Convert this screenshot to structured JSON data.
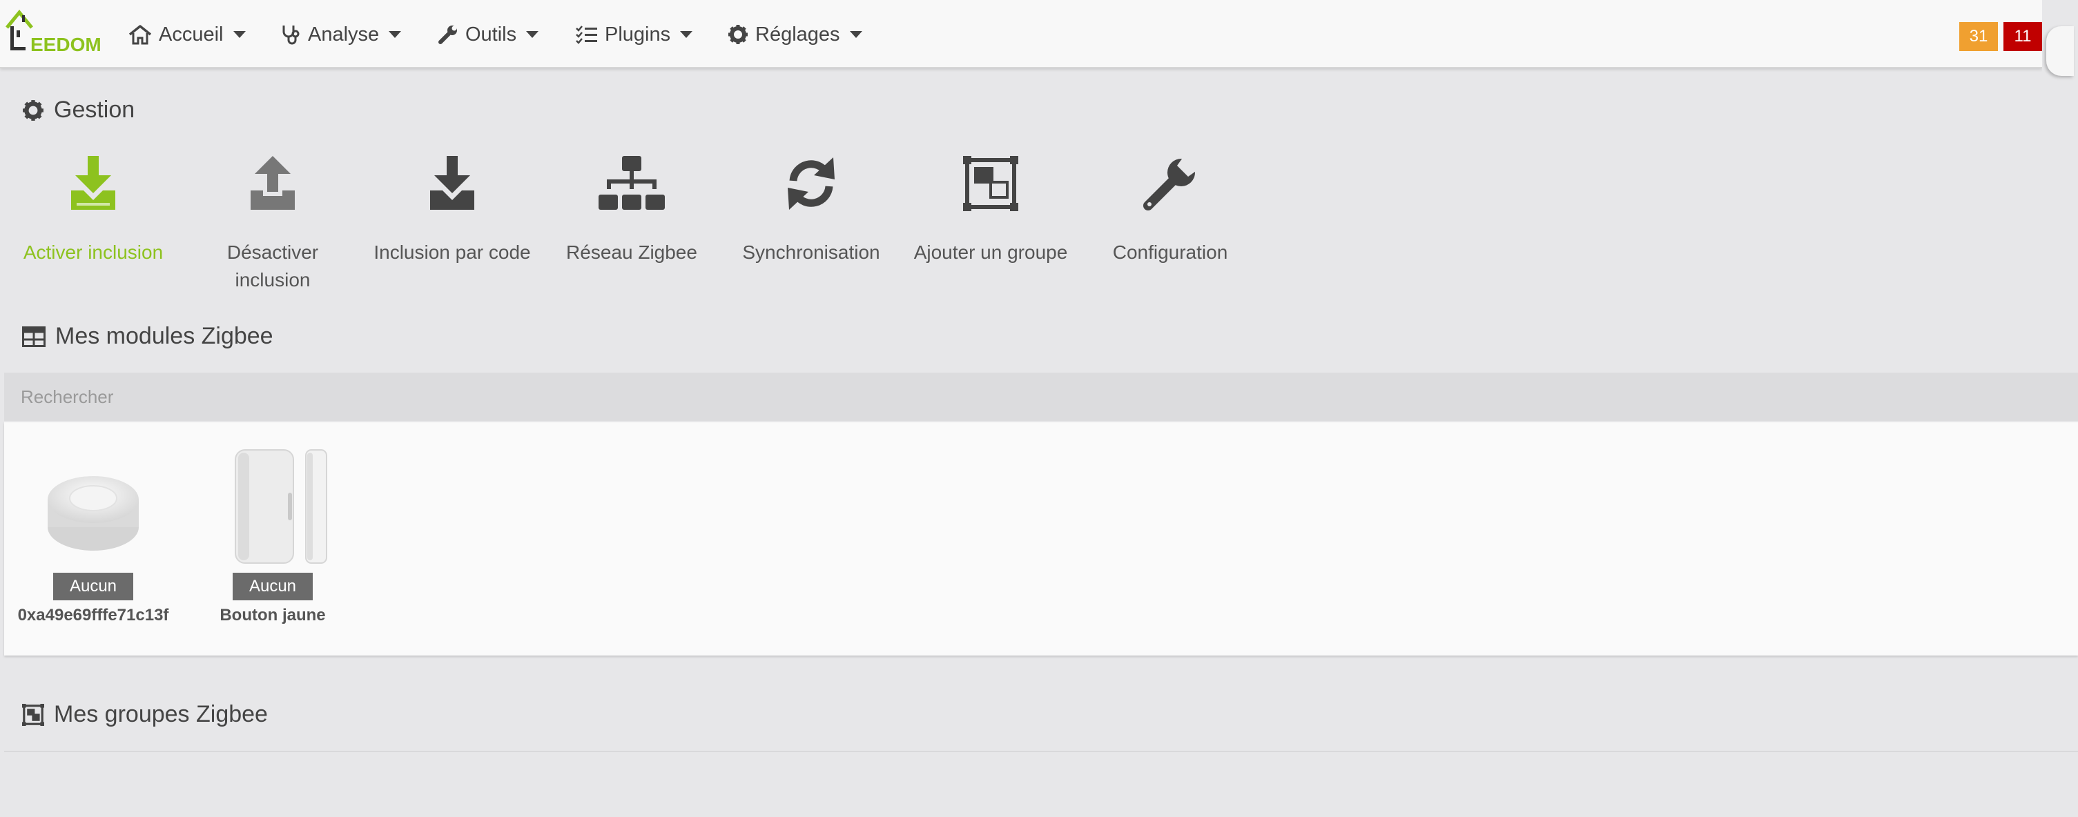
{
  "app": {
    "logo_text": "EEDOM",
    "brand_color": "#8dc21f"
  },
  "nav": {
    "items": [
      {
        "label": "Accueil",
        "icon": "home-icon"
      },
      {
        "label": "Analyse",
        "icon": "stethoscope-icon"
      },
      {
        "label": "Outils",
        "icon": "wrench-icon"
      },
      {
        "label": "Plugins",
        "icon": "tasks-icon"
      },
      {
        "label": "Réglages",
        "icon": "gear-icon"
      }
    ],
    "badges": [
      {
        "value": "31",
        "color": "#f0a030"
      },
      {
        "value": "11",
        "color": "#c00000"
      }
    ]
  },
  "gestion": {
    "title": "Gestion",
    "actions": [
      {
        "label": "Activer inclusion",
        "icon": "download-icon",
        "active": true
      },
      {
        "label": "Désactiver inclusion",
        "icon": "upload-icon",
        "active": false
      },
      {
        "label": "Inclusion par code",
        "icon": "download-icon",
        "active": false
      },
      {
        "label": "Réseau Zigbee",
        "icon": "sitemap-icon",
        "active": false
      },
      {
        "label": "Synchronisation",
        "icon": "sync-icon",
        "active": false
      },
      {
        "label": "Ajouter un groupe",
        "icon": "group-object-icon",
        "active": false
      },
      {
        "label": "Configuration",
        "icon": "wrench-icon",
        "active": false
      }
    ]
  },
  "modules": {
    "title": "Mes modules Zigbee",
    "search_placeholder": "Rechercher",
    "items": [
      {
        "badge": "Aucun",
        "name": "0xa49e69fffe71c13f",
        "image": "round-button-image"
      },
      {
        "badge": "Aucun",
        "name": "Bouton jaune",
        "image": "door-sensor-image"
      }
    ]
  },
  "groups": {
    "title": "Mes groupes Zigbee"
  }
}
